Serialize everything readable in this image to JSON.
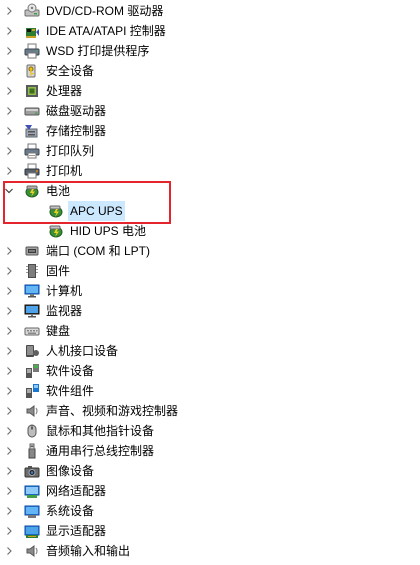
{
  "colors": {
    "selection": "#cce8ff",
    "highlight_border": "#e5252e"
  },
  "tree": [
    {
      "label": "DVD/CD-ROM 驱动器",
      "icon": "dvd-drive-icon",
      "expanded": false
    },
    {
      "label": "IDE ATA/ATAPI 控制器",
      "icon": "ide-controller-icon",
      "expanded": false
    },
    {
      "label": "WSD 打印提供程序",
      "icon": "wsd-printer-icon",
      "expanded": false
    },
    {
      "label": "安全设备",
      "icon": "security-device-icon",
      "expanded": false
    },
    {
      "label": "处理器",
      "icon": "processor-icon",
      "expanded": false
    },
    {
      "label": "磁盘驱动器",
      "icon": "disk-drive-icon",
      "expanded": false
    },
    {
      "label": "存储控制器",
      "icon": "storage-controller-icon",
      "expanded": false
    },
    {
      "label": "打印队列",
      "icon": "print-queue-icon",
      "expanded": false
    },
    {
      "label": "打印机",
      "icon": "printer-icon",
      "expanded": false
    },
    {
      "label": "电池",
      "icon": "battery-icon",
      "expanded": true
    },
    {
      "label": "APC UPS",
      "icon": "battery-device-icon",
      "child": true,
      "selected": true
    },
    {
      "label": "HID UPS 电池",
      "icon": "battery-device-icon",
      "child": true
    },
    {
      "label": "端口 (COM 和 LPT)",
      "icon": "port-icon",
      "expanded": false
    },
    {
      "label": "固件",
      "icon": "firmware-icon",
      "expanded": false
    },
    {
      "label": "计算机",
      "icon": "computer-icon",
      "expanded": false
    },
    {
      "label": "监视器",
      "icon": "monitor-icon",
      "expanded": false
    },
    {
      "label": "键盘",
      "icon": "keyboard-icon",
      "expanded": false
    },
    {
      "label": "人机接口设备",
      "icon": "hid-icon",
      "expanded": false
    },
    {
      "label": "软件设备",
      "icon": "software-device-icon",
      "expanded": false
    },
    {
      "label": "软件组件",
      "icon": "software-component-icon",
      "expanded": false
    },
    {
      "label": "声音、视频和游戏控制器",
      "icon": "sound-icon",
      "expanded": false
    },
    {
      "label": "鼠标和其他指针设备",
      "icon": "mouse-icon",
      "expanded": false
    },
    {
      "label": "通用串行总线控制器",
      "icon": "usb-icon",
      "expanded": false
    },
    {
      "label": "图像设备",
      "icon": "camera-icon",
      "expanded": false
    },
    {
      "label": "网络适配器",
      "icon": "network-adapter-icon",
      "expanded": false
    },
    {
      "label": "系统设备",
      "icon": "system-device-icon",
      "expanded": false
    },
    {
      "label": "显示适配器",
      "icon": "display-adapter-icon",
      "expanded": false
    },
    {
      "label": "音频输入和输出",
      "icon": "audio-io-icon",
      "expanded": false
    }
  ]
}
